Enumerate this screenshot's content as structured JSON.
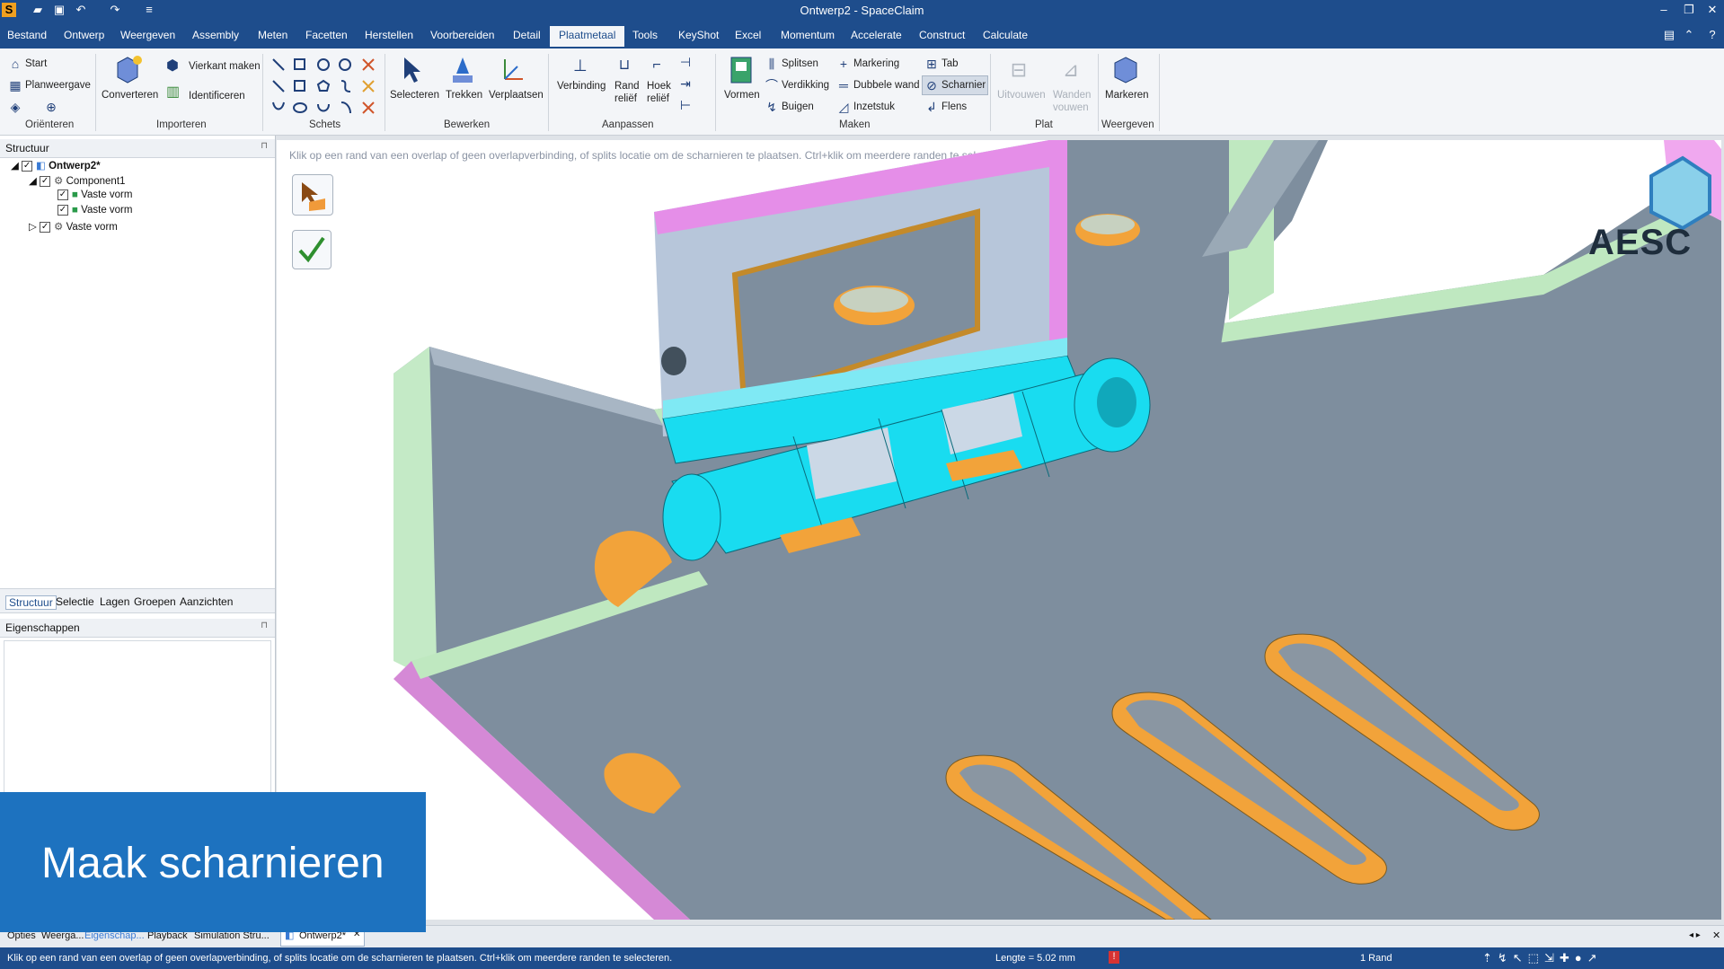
{
  "window": {
    "title": "Ontwerp2 - SpaceClaim"
  },
  "menu": [
    "Bestand",
    "Ontwerp",
    "Weergeven",
    "Assembly",
    "Meten",
    "Facetten",
    "Herstellen",
    "Voorbereiden",
    "Detail",
    "Plaatmetaal",
    "Tools",
    "KeyShot",
    "Excel",
    "Momentum",
    "Accelerate",
    "Construct",
    "Calculate"
  ],
  "ribbon": {
    "orienteren": {
      "start": "Start",
      "plan": "Planweergave",
      "group": "Oriënteren"
    },
    "importeren": {
      "converteren": "Converteren",
      "vierkant": "Vierkant maken",
      "identificeren": "Identificeren",
      "group": "Importeren"
    },
    "schets": {
      "group": "Schets"
    },
    "bewerken": {
      "selecteren": "Selecteren",
      "trekken": "Trekken",
      "verplaatsen": "Verplaatsen",
      "group": "Bewerken"
    },
    "aanpassen": {
      "verbinding": "Verbinding",
      "rand1": "Rand",
      "rand2": "reliëf",
      "hoek1": "Hoek",
      "hoek2": "reliëf",
      "group": "Aanpassen"
    },
    "maken": {
      "vormen": "Vormen",
      "splitsen": "Splitsen",
      "verdikking": "Verdikking",
      "buigen": "Buigen",
      "markering": "Markering",
      "dubbele": "Dubbele wand",
      "inzetstuk": "Inzetstuk",
      "tab": "Tab",
      "scharnier": "Scharnier",
      "flens": "Flens",
      "group": "Maken"
    },
    "plat": {
      "uitvouwen": "Uitvouwen",
      "wanden1": "Wanden",
      "wanden2": "vouwen",
      "group": "Plat"
    },
    "weergeven": {
      "markeren": "Markeren",
      "group": "Weergeven"
    }
  },
  "structure": {
    "header": "Structuur",
    "tree": [
      {
        "label": "Ontwerp2*"
      },
      {
        "label": "Component1"
      },
      {
        "label": "Vaste vorm"
      },
      {
        "label": "Vaste vorm"
      },
      {
        "label": "Vaste vorm"
      }
    ],
    "tabs": [
      "Structuur",
      "Selectie",
      "Lagen",
      "Groepen",
      "Aanzichten"
    ]
  },
  "properties": {
    "header": "Eigenschappen"
  },
  "viewport": {
    "hint": "Klik op een rand van een overlap of geen overlapverbinding, of splits locatie om de scharnieren te plaatsen. Ctrl+klik om meerdere randen te selecteren.",
    "logo": "AESC"
  },
  "caption": "Maak scharnieren",
  "doctabs": {
    "left": [
      "Opties",
      "Weerga...",
      "Eigenschap...",
      "Playback",
      "Simulation Stru..."
    ],
    "doc": "Ontwerp2*"
  },
  "status": {
    "message": "Klik op een rand van een overlap of geen overlapverbinding, of splits locatie om de scharnieren te plaatsen. Ctrl+klik om meerdere randen te selecteren.",
    "length": "Lengte = 5.02 mm",
    "selection": "1 Rand"
  },
  "colors": {
    "accent": "#1e4d8c",
    "hinge": "#19dcf0",
    "plate": "#7e8e9e",
    "edge": "#bfe8c0",
    "face_pink": "#e58ee8",
    "slot": "#f2a33a"
  }
}
